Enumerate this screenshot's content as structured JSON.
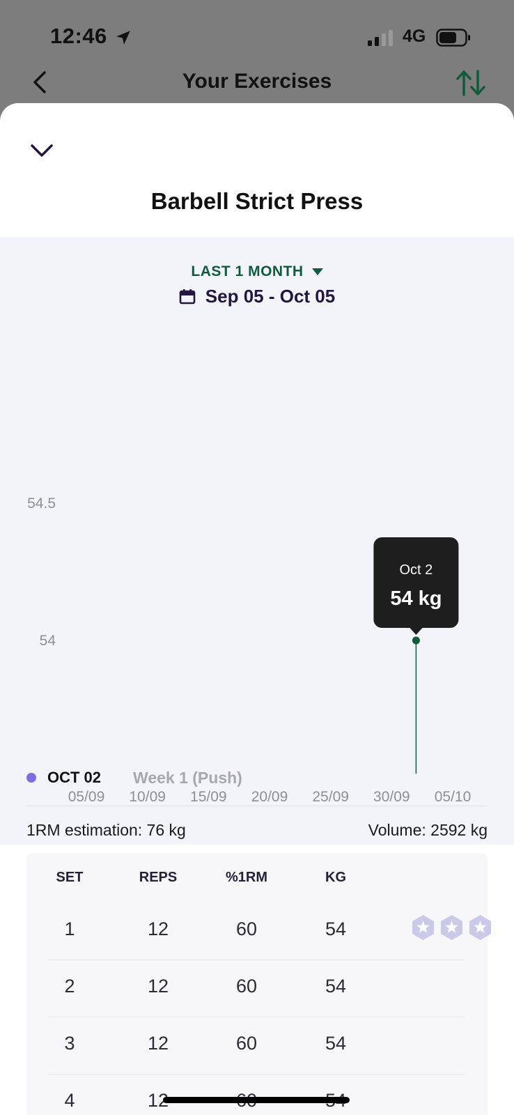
{
  "status": {
    "time": "12:46",
    "network": "4G"
  },
  "nav": {
    "title": "Your Exercises"
  },
  "sheet": {
    "exercise_title": "Barbell Strict Press",
    "range_label": "LAST 1 MONTH",
    "date_range": "Sep 05 - Oct 05"
  },
  "chart_data": {
    "type": "line",
    "x_ticks": [
      "05/09",
      "10/09",
      "15/09",
      "20/09",
      "25/09",
      "30/09",
      "05/10"
    ],
    "y_ticks": [
      "54.5",
      "54"
    ],
    "series": [
      {
        "x": [
          "2023-10-02"
        ],
        "y": [
          54
        ]
      }
    ],
    "xlim": [
      "2023-09-05",
      "2023-10-05"
    ],
    "ylim": [
      53.5,
      54.5
    ],
    "tooltip": {
      "date": "Oct 2",
      "value": "54 kg"
    },
    "colors": {
      "line": "#0f5b3b",
      "tooltip_bg": "#1e1e1e"
    }
  },
  "session": {
    "date": "OCT 02",
    "week": "Week 1 (Push)",
    "one_rm": "1RM estimation: 76 kg",
    "volume": "Volume: 2592 kg",
    "headers": [
      "SET",
      "REPS",
      "%1RM",
      "KG"
    ],
    "rows": [
      {
        "set": "1",
        "reps": "12",
        "pct": "60",
        "kg": "54"
      },
      {
        "set": "2",
        "reps": "12",
        "pct": "60",
        "kg": "54"
      },
      {
        "set": "3",
        "reps": "12",
        "pct": "60",
        "kg": "54"
      },
      {
        "set": "4",
        "reps": "12",
        "pct": "60",
        "kg": "54"
      }
    ],
    "badge_count": 3
  }
}
